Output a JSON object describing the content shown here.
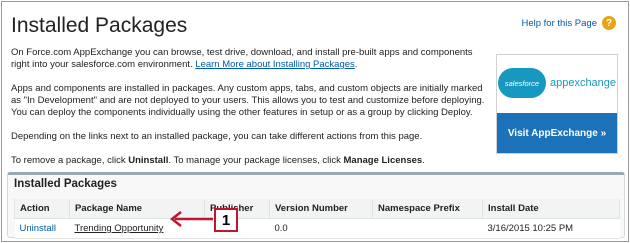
{
  "header": {
    "title": "Installed Packages",
    "help_label": "Help for this Page",
    "help_icon": "?"
  },
  "intro": {
    "p1_text": "On Force.com AppExchange you can browse, test drive, download, and install pre-built apps and components right into your salesforce.com environment. ",
    "p1_link": "Learn More about Installing Packages",
    "p1_end": ".",
    "p2": "Apps and components are installed in packages. Any custom apps, tabs, and custom objects are initially marked as \"In Development\" and are not deployed to your users. This allows you to test and customize before deploying. You can deploy the components individually using the other features in setup or as a group by clicking Deploy.",
    "p3": "Depending on the links next to an installed package, you can take different actions from this page.",
    "p4_a": "To remove a package, click ",
    "p4_b": "Uninstall",
    "p4_c": ". To manage your package licenses, click ",
    "p4_d": "Manage Licenses",
    "p4_e": "."
  },
  "appexchange": {
    "cloud_label": "salesforce",
    "word": "appexchange",
    "button_label": "Visit AppExchange »"
  },
  "panel": {
    "title": "Installed Packages",
    "columns": [
      "Action",
      "Package Name",
      "Publisher",
      "Version Number",
      "Namespace Prefix",
      "Install Date"
    ],
    "rows": [
      {
        "action": "Uninstall",
        "package_name": "Trending Opportunity",
        "publisher": "",
        "version": "0.0",
        "namespace": "",
        "install_date": "3/16/2015 10:25 PM"
      }
    ]
  },
  "callout": {
    "label": "1"
  },
  "colors": {
    "link": "#015ba7",
    "accent": "#1c72b8",
    "callout": "#c0152f",
    "help_icon": "#e8a317"
  }
}
